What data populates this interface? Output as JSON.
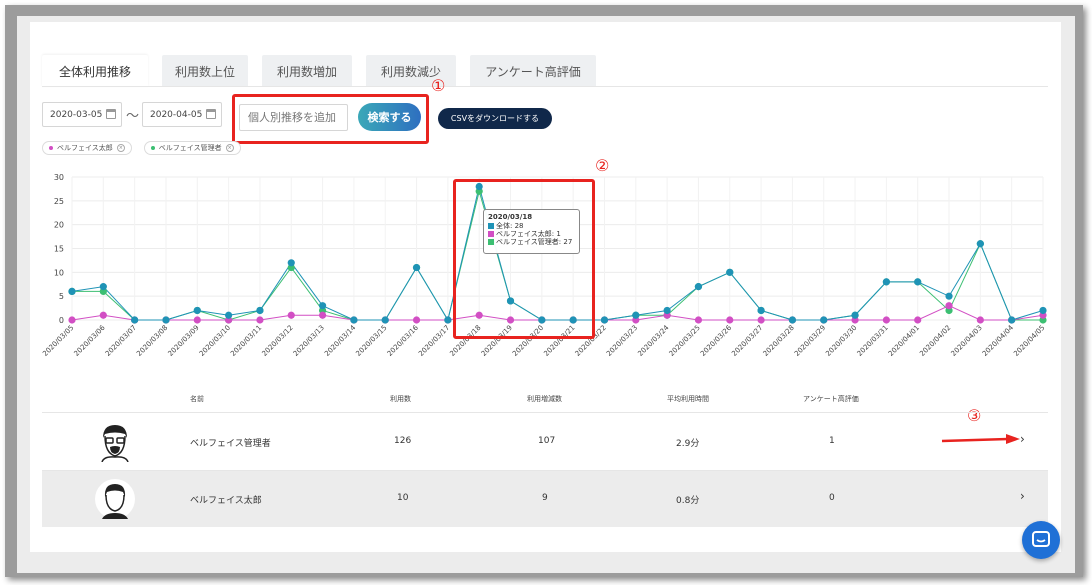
{
  "tabs": [
    {
      "label": "全体利用推移",
      "active": true
    },
    {
      "label": "利用数上位",
      "active": false
    },
    {
      "label": "利用数増加",
      "active": false
    },
    {
      "label": "利用数減少",
      "active": false
    },
    {
      "label": "アンケート高評価",
      "active": false
    }
  ],
  "filters": {
    "start_date": "2020-03-05",
    "end_date": "2020-04-05",
    "range_separator": "〜",
    "person_input_placeholder": "個人別推移を追加",
    "search_label": "検索する",
    "csv_label": "CSVをダウンロードする"
  },
  "annotations": {
    "one": "①",
    "two": "②",
    "three": "③"
  },
  "legend_chips": [
    {
      "label": "ベルフェイス太郎",
      "color": "#d24fc4"
    },
    {
      "label": "ベルフェイス管理者",
      "color": "#3cbf72"
    }
  ],
  "chart_data": {
    "type": "line",
    "x": [
      "2020/03/05",
      "2020/03/06",
      "2020/03/07",
      "2020/03/08",
      "2020/03/09",
      "2020/03/10",
      "2020/03/11",
      "2020/03/12",
      "2020/03/13",
      "2020/03/14",
      "2020/03/15",
      "2020/03/16",
      "2020/03/17",
      "2020/03/18",
      "2020/03/19",
      "2020/03/20",
      "2020/03/21",
      "2020/03/22",
      "2020/03/23",
      "2020/03/24",
      "2020/03/25",
      "2020/03/26",
      "2020/03/27",
      "2020/03/28",
      "2020/03/29",
      "2020/03/30",
      "2020/03/31",
      "2020/04/01",
      "2020/04/02",
      "2020/04/03",
      "2020/04/04",
      "2020/04/05"
    ],
    "ylim": [
      0,
      30
    ],
    "yticks": [
      0,
      5,
      10,
      15,
      20,
      25,
      30
    ],
    "grid": true,
    "series": [
      {
        "name": "全体",
        "color": "#1f93b6",
        "values": [
          6,
          7,
          0,
          0,
          2,
          1,
          2,
          12,
          3,
          0,
          0,
          11,
          0,
          28,
          4,
          0,
          0,
          0,
          1,
          2,
          7,
          10,
          2,
          0,
          0,
          1,
          8,
          8,
          5,
          16,
          0,
          2
        ]
      },
      {
        "name": "ベルフェイス太郎",
        "color": "#d24fc4",
        "values": [
          0,
          1,
          0,
          0,
          0,
          0,
          0,
          1,
          1,
          0,
          0,
          0,
          0,
          1,
          0,
          0,
          0,
          0,
          0,
          1,
          0,
          0,
          0,
          0,
          0,
          0,
          0,
          0,
          3,
          0,
          0,
          1
        ]
      },
      {
        "name": "ベルフェイス管理者",
        "color": "#3cbf72",
        "values": [
          6,
          6,
          0,
          0,
          2,
          0,
          2,
          11,
          2,
          0,
          0,
          11,
          0,
          27,
          4,
          0,
          0,
          0,
          1,
          1,
          7,
          10,
          2,
          0,
          0,
          1,
          8,
          8,
          2,
          16,
          0,
          0
        ]
      }
    ],
    "tooltip": {
      "date": "2020/03/18",
      "lines": [
        "全体: 28",
        "ベルフェイス太郎: 1",
        "ベルフェイス管理者: 27"
      ]
    }
  },
  "table": {
    "headers": {
      "name": "名前",
      "usage": "利用数",
      "change": "利用増減数",
      "avg_time": "平均利用時間",
      "survey": "アンケート高評価"
    },
    "rows": [
      {
        "name": "ベルフェイス管理者",
        "usage": "126",
        "change": "107",
        "avg_time": "2.9分",
        "survey": "1",
        "avatar": "glasses-man-icon"
      },
      {
        "name": "ベルフェイス太郎",
        "usage": "10",
        "change": "9",
        "avg_time": "0.8分",
        "survey": "0",
        "avatar": "man-icon"
      }
    ]
  },
  "colors": {
    "accent_red": "#e8231f",
    "navy": "#10284a",
    "chat_blue": "#1f70d6"
  }
}
